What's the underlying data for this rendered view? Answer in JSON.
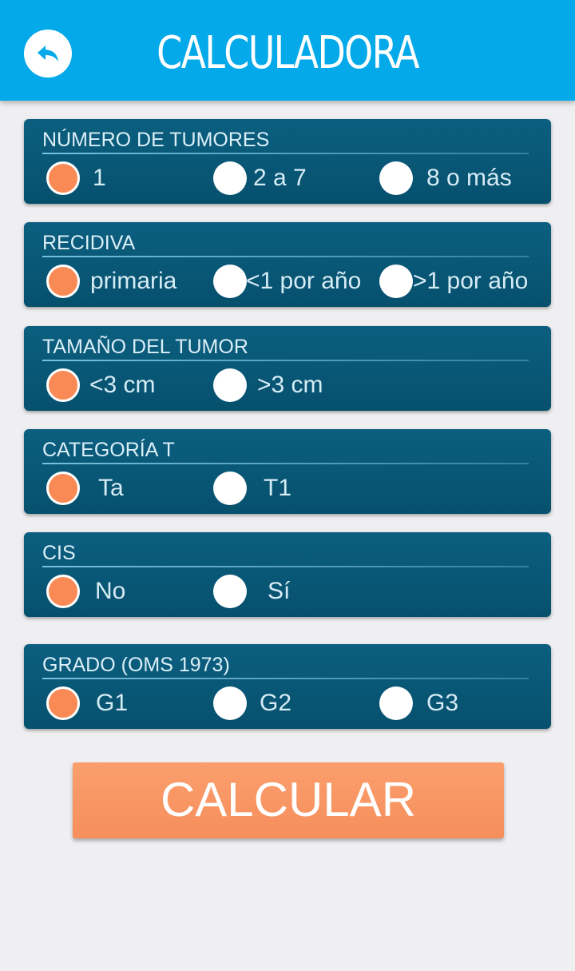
{
  "header": {
    "title": "CALCULADORA",
    "back_icon": "undo-arrow-icon"
  },
  "colors": {
    "header_bg": "#04a9e9",
    "card_bg": "#0a5a7a",
    "radio_selected": "#f98a55",
    "button_bg": "#f8965f"
  },
  "groups": [
    {
      "title": "NÚMERO DE TUMORES",
      "options": [
        {
          "label": "1",
          "selected": true
        },
        {
          "label": "2 a 7",
          "selected": false
        },
        {
          "label": "8 o más",
          "selected": false
        }
      ]
    },
    {
      "title": "RECIDIVA",
      "options": [
        {
          "label": "primaria",
          "selected": true
        },
        {
          "label": "<1 por año",
          "selected": false
        },
        {
          "label": ">1 por año",
          "selected": false
        }
      ]
    },
    {
      "title": "TAMAÑO DEL TUMOR",
      "options": [
        {
          "label": "<3 cm",
          "selected": true
        },
        {
          "label": ">3 cm",
          "selected": false
        }
      ]
    },
    {
      "title": "CATEGORÍA T",
      "options": [
        {
          "label": "Ta",
          "selected": true
        },
        {
          "label": "T1",
          "selected": false
        }
      ]
    },
    {
      "title": "CIS",
      "options": [
        {
          "label": "No",
          "selected": true
        },
        {
          "label": "Sí",
          "selected": false
        }
      ]
    },
    {
      "title": "GRADO (OMS 1973)",
      "options": [
        {
          "label": "G1",
          "selected": true
        },
        {
          "label": "G2",
          "selected": false
        },
        {
          "label": "G3",
          "selected": false
        }
      ]
    }
  ],
  "calculate_button": {
    "label": "CALCULAR"
  }
}
